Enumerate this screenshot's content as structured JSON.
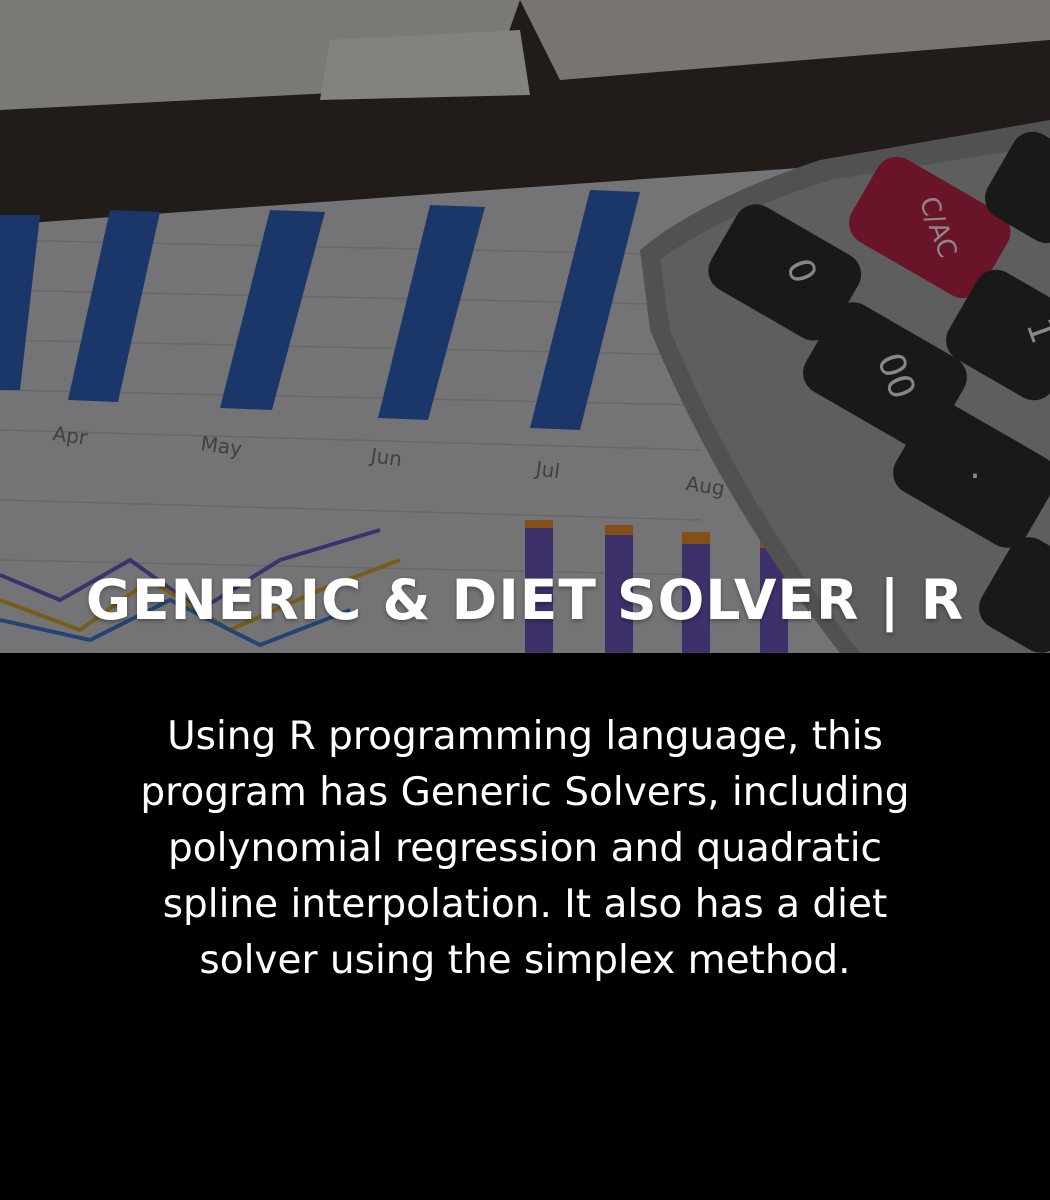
{
  "card": {
    "title": "GENERIC & DIET SOLVER | R",
    "description": "Using R programming language, this program has Generic Solvers, including polynomial regression and quadratic spline interpolation. It also has a diet solver using the simplex method."
  },
  "background_photo": {
    "chart_month_labels": [
      "Apr",
      "May",
      "Jun",
      "Jul",
      "Aug"
    ],
    "calculator_keys": [
      "0",
      "C/AC",
      "00",
      "1",
      "."
    ]
  }
}
